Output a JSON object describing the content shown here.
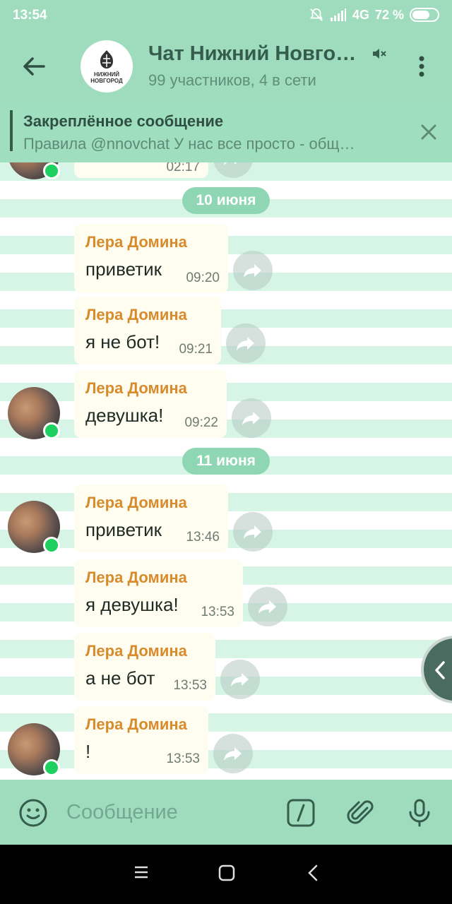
{
  "status": {
    "time": "13:54",
    "network": "4G",
    "battery": "72 %",
    "battery_level": 0.72
  },
  "header": {
    "title": "Чат Нижний Новго…",
    "subtitle": "99 участников, 4 в сети",
    "logo_text_line1": "НИЖНИЙ",
    "logo_text_line2": "НОВГОРОД"
  },
  "pinned": {
    "title": "Закреплённое сообщение",
    "text": "Правила @nnovchat  У нас все просто - общ…"
  },
  "partial_message": {
    "time": "02:17"
  },
  "dates": [
    "10 июня",
    "11 июня"
  ],
  "messages": [
    {
      "author": "Лера Домина",
      "text": "приветик",
      "time": "09:20"
    },
    {
      "author": "Лера Домина",
      "text": "я не бот!",
      "time": "09:21"
    },
    {
      "author": "Лера Домина",
      "text": "девушка!",
      "time": "09:22"
    },
    {
      "author": "Лера Домина",
      "text": "приветик",
      "time": "13:46"
    },
    {
      "author": "Лера Домина",
      "text": "я девушка!",
      "time": "13:53"
    },
    {
      "author": "Лера Домина",
      "text": "а не бот",
      "time": "13:53"
    },
    {
      "author": "Лера Домина",
      "text": "!",
      "time": "13:53"
    }
  ],
  "input": {
    "placeholder": "Сообщение"
  },
  "icons": {
    "back": "arrow-left-icon",
    "mute": "muted-speaker-icon",
    "more": "more-vertical-icon",
    "close": "close-icon",
    "forward": "share-arrow-icon",
    "emoji": "smiley-icon",
    "command": "slash-command-icon",
    "attach": "paperclip-icon",
    "mic": "microphone-icon"
  },
  "colors": {
    "header": "#9edcbd",
    "author": "#d88b2c",
    "online": "#1ed05f",
    "date_chip": "#8fd6b5"
  }
}
